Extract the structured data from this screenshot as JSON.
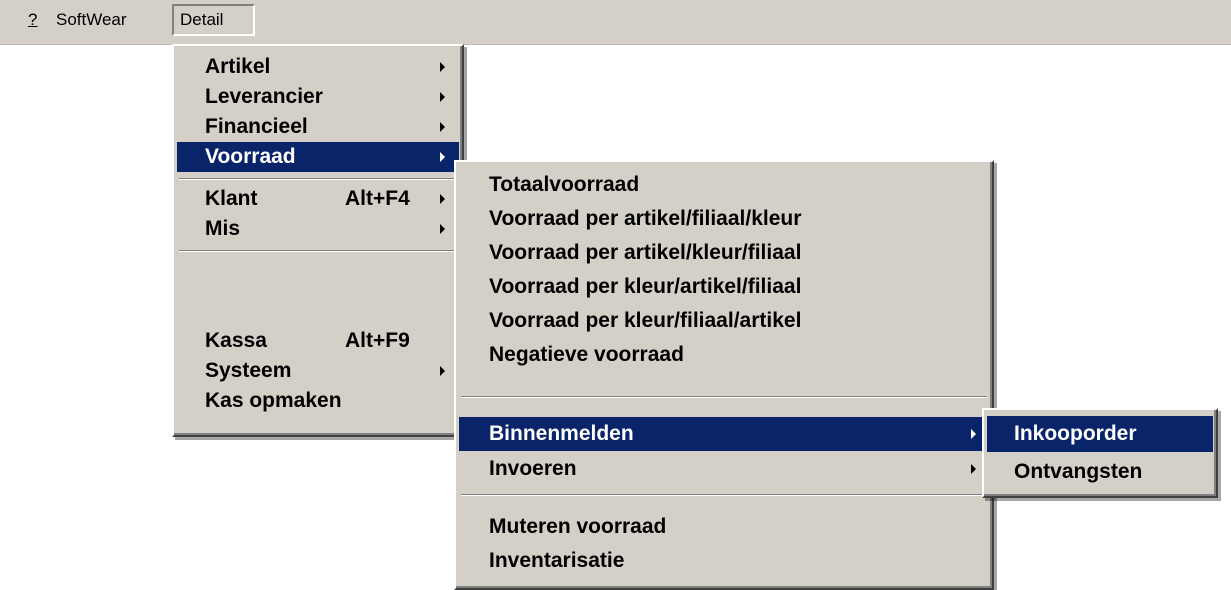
{
  "menubar": {
    "items": [
      {
        "label": "?"
      },
      {
        "label": "SoftWear"
      },
      {
        "label": "Detail"
      }
    ]
  },
  "detail_menu": {
    "items": [
      {
        "label": "Artikel",
        "submenu": true
      },
      {
        "label": "Leverancier",
        "submenu": true
      },
      {
        "label": "Financieel",
        "submenu": true
      },
      {
        "label": "Voorraad",
        "submenu": true,
        "highlighted": true
      },
      {
        "label": "Klant",
        "shortcut": "Alt+F4",
        "submenu": true
      },
      {
        "label": "Mis",
        "submenu": true
      },
      {
        "label": "Kassa",
        "shortcut": "Alt+F9"
      },
      {
        "label": "Systeem",
        "submenu": true
      },
      {
        "label": "Kas opmaken"
      }
    ]
  },
  "voorraad_menu": {
    "items": [
      {
        "label": "Totaalvoorraad"
      },
      {
        "label": "Voorraad per artikel/filiaal/kleur"
      },
      {
        "label": "Voorraad per artikel/kleur/filiaal"
      },
      {
        "label": "Voorraad per kleur/artikel/filiaal"
      },
      {
        "label": "Voorraad per kleur/filiaal/artikel"
      },
      {
        "label": "Negatieve voorraad"
      },
      {
        "label": "Binnenmelden",
        "submenu": true,
        "highlighted": true
      },
      {
        "label": "Invoeren",
        "submenu": true
      },
      {
        "label": "Muteren voorraad"
      },
      {
        "label": "Inventarisatie"
      }
    ]
  },
  "binnenmelden_menu": {
    "items": [
      {
        "label": "Inkooporder",
        "highlighted": true
      },
      {
        "label": "Ontvangsten"
      }
    ]
  },
  "colors": {
    "menu_bg": "#d4d0c8",
    "highlight_bg": "#0a246a",
    "highlight_text": "#ffffff"
  }
}
